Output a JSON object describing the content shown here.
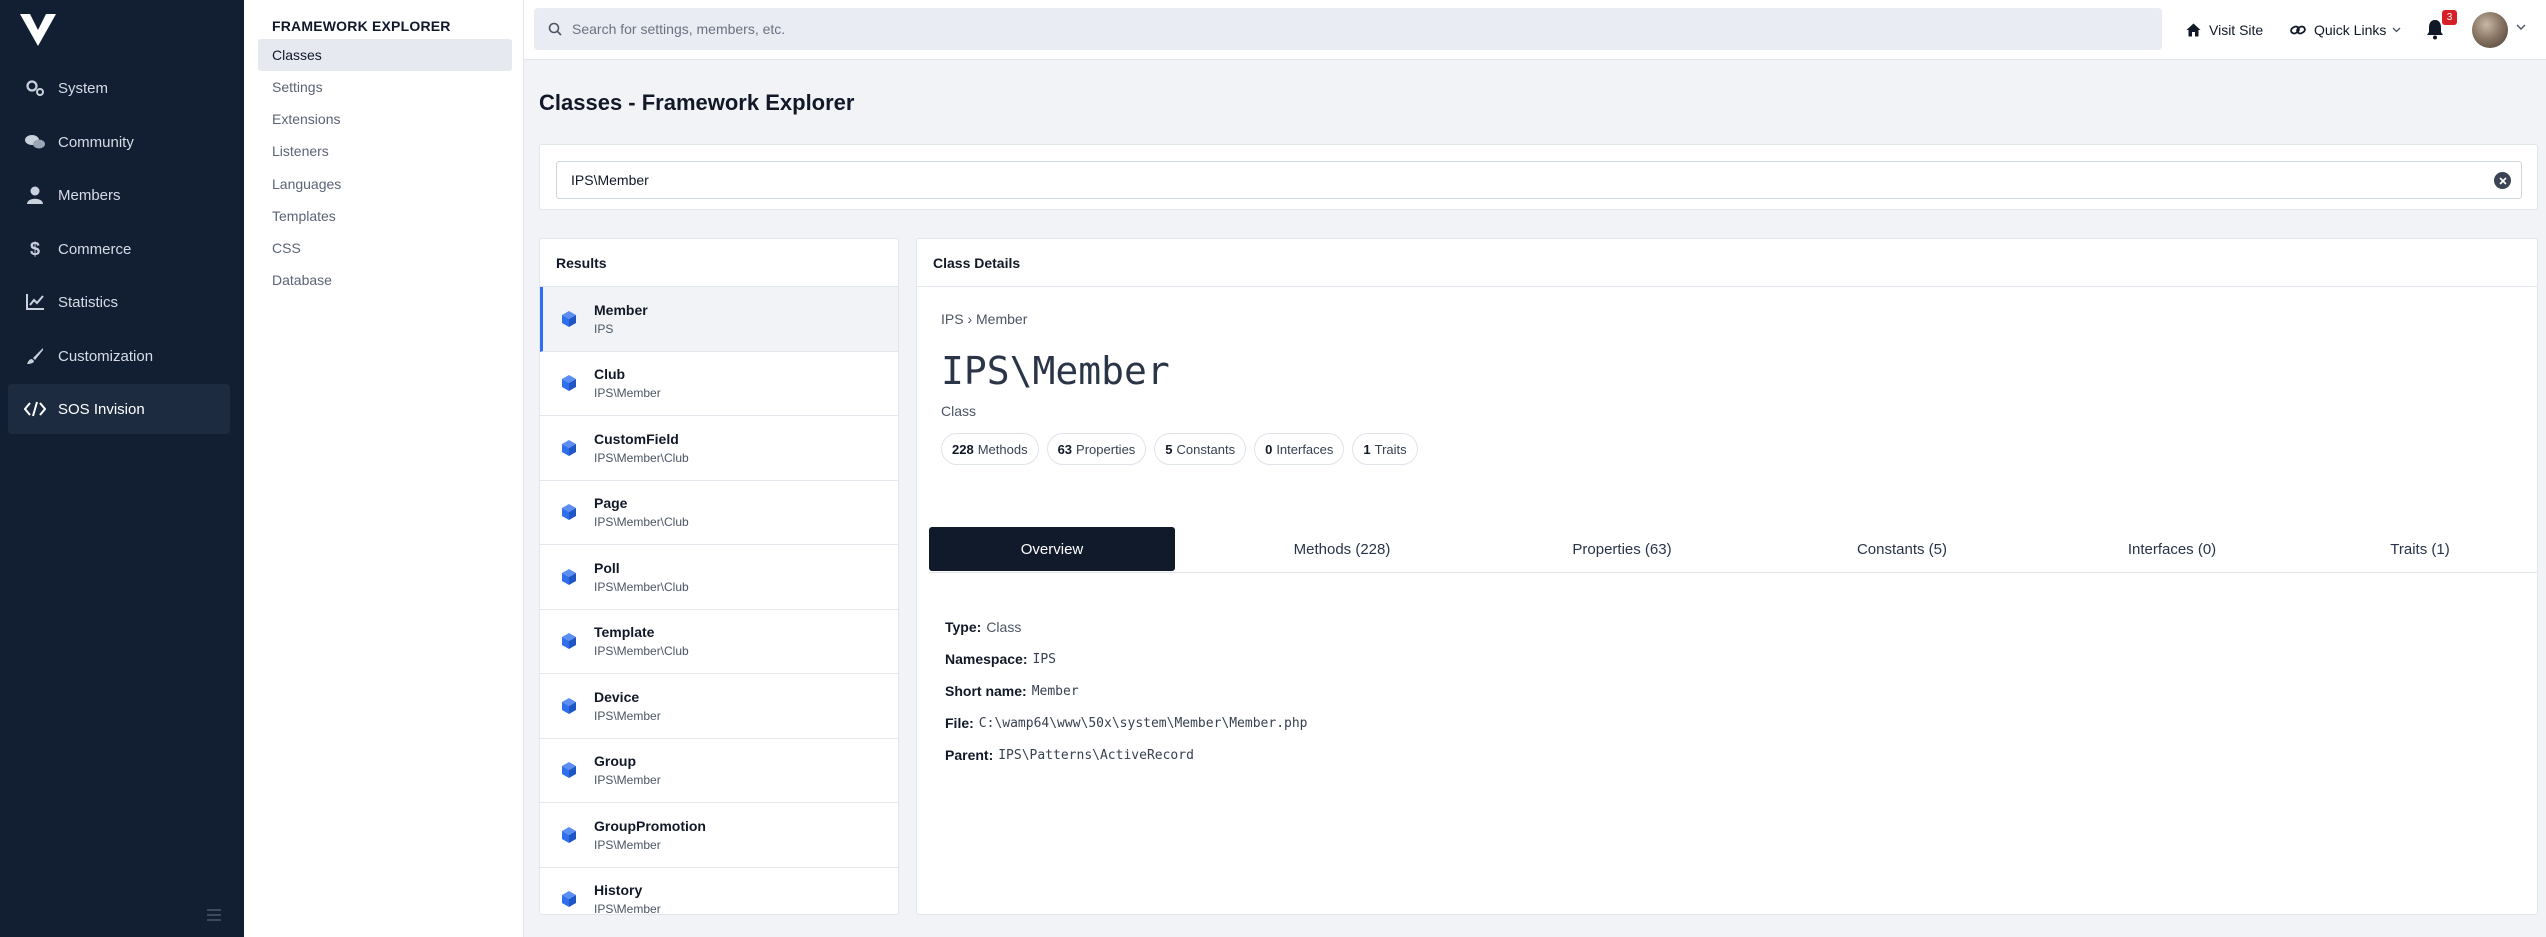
{
  "nav": {
    "items": [
      {
        "label": "System",
        "icon": "gears-icon"
      },
      {
        "label": "Community",
        "icon": "comments-icon"
      },
      {
        "label": "Members",
        "icon": "user-icon"
      },
      {
        "label": "Commerce",
        "icon": "dollar-icon"
      },
      {
        "label": "Statistics",
        "icon": "chart-line-icon"
      },
      {
        "label": "Customization",
        "icon": "brush-icon"
      },
      {
        "label": "SOS Invision",
        "icon": "code-icon"
      }
    ],
    "active_index": 6
  },
  "subnav": {
    "heading": "FRAMEWORK EXPLORER",
    "items": [
      "Classes",
      "Settings",
      "Extensions",
      "Listeners",
      "Languages",
      "Templates",
      "CSS",
      "Database"
    ],
    "active_index": 0
  },
  "topbar": {
    "search_placeholder": "Search for settings, members, etc.",
    "visit_site": "Visit Site",
    "quick_links": "Quick Links",
    "notification_count": "3"
  },
  "page": {
    "title": "Classes - Framework Explorer",
    "class_search_value": "IPS\\Member"
  },
  "results": {
    "heading": "Results",
    "items": [
      {
        "name": "Member",
        "ns": "IPS"
      },
      {
        "name": "Club",
        "ns": "IPS\\Member"
      },
      {
        "name": "CustomField",
        "ns": "IPS\\Member\\Club"
      },
      {
        "name": "Page",
        "ns": "IPS\\Member\\Club"
      },
      {
        "name": "Poll",
        "ns": "IPS\\Member\\Club"
      },
      {
        "name": "Template",
        "ns": "IPS\\Member\\Club"
      },
      {
        "name": "Device",
        "ns": "IPS\\Member"
      },
      {
        "name": "Group",
        "ns": "IPS\\Member"
      },
      {
        "name": "GroupPromotion",
        "ns": "IPS\\Member"
      },
      {
        "name": "History",
        "ns": "IPS\\Member"
      }
    ],
    "active_index": 0
  },
  "details": {
    "heading": "Class Details",
    "breadcrumb": "IPS › Member",
    "class_name": "IPS\\Member",
    "kind": "Class",
    "stats": [
      {
        "count": "228",
        "label": "Methods"
      },
      {
        "count": "63",
        "label": "Properties"
      },
      {
        "count": "5",
        "label": "Constants"
      },
      {
        "count": "0",
        "label": "Interfaces"
      },
      {
        "count": "1",
        "label": "Traits"
      }
    ],
    "tabs": [
      "Overview",
      "Methods (228)",
      "Properties (63)",
      "Constants (5)",
      "Interfaces (0)",
      "Traits (1)"
    ],
    "active_tab": 0,
    "props": [
      {
        "label": "Type:",
        "value": "Class",
        "mono": false
      },
      {
        "label": "Namespace:",
        "value": "IPS",
        "mono": true
      },
      {
        "label": "Short name:",
        "value": "Member",
        "mono": true
      },
      {
        "label": "File:",
        "value": "C:\\wamp64\\www\\50x\\system\\Member\\Member.php",
        "mono": true
      },
      {
        "label": "Parent:",
        "value": "IPS\\Patterns\\ActiveRecord",
        "mono": true
      }
    ]
  }
}
